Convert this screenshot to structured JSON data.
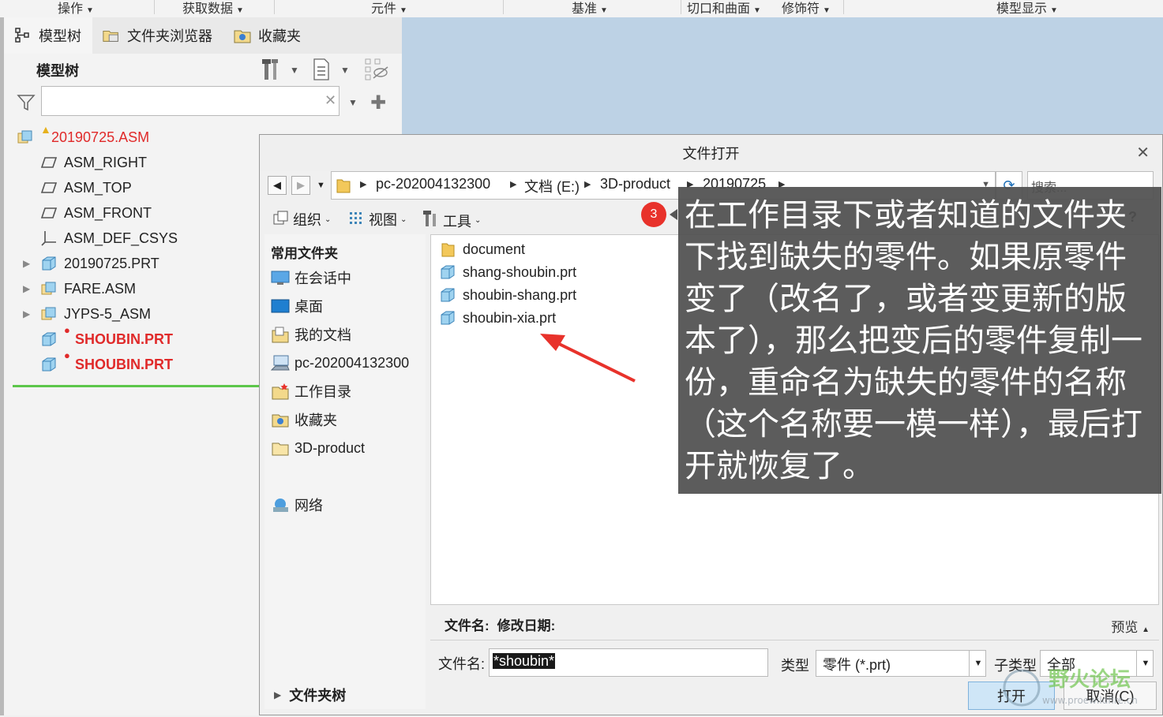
{
  "ribbon": {
    "groups": [
      "操作",
      "获取数据",
      "元件",
      "基准",
      "切口和曲面",
      "修饰符",
      "模型显示"
    ]
  },
  "left_panel": {
    "tabs": [
      {
        "label": "模型树",
        "icon": "model-tree-icon"
      },
      {
        "label": "文件夹浏览器",
        "icon": "folder-browser-icon"
      },
      {
        "label": "收藏夹",
        "icon": "favorites-icon"
      }
    ],
    "title": "模型树",
    "filter_placeholder": "",
    "tree": [
      {
        "label": "20190725.ASM",
        "style": "warn",
        "icon": "assembly-icon"
      },
      {
        "label": "ASM_RIGHT",
        "style": "normal",
        "icon": "datum-plane-icon"
      },
      {
        "label": "ASM_TOP",
        "style": "normal",
        "icon": "datum-plane-icon"
      },
      {
        "label": "ASM_FRONT",
        "style": "normal",
        "icon": "datum-plane-icon"
      },
      {
        "label": "ASM_DEF_CSYS",
        "style": "normal",
        "icon": "csys-icon"
      },
      {
        "label": "20190725.PRT",
        "style": "normal",
        "icon": "part-icon"
      },
      {
        "label": "FARE.ASM",
        "style": "normal",
        "icon": "assembly-icon"
      },
      {
        "label": "JYPS-5_ASM",
        "style": "normal",
        "icon": "assembly-icon"
      },
      {
        "label": "SHOUBIN.PRT",
        "style": "missing",
        "icon": "part-icon"
      },
      {
        "label": "SHOUBIN.PRT",
        "style": "missing",
        "icon": "part-icon"
      }
    ]
  },
  "dialog": {
    "title": "文件打开",
    "breadcrumbs": [
      "pc-202004132300",
      "文档 (E:)",
      "3D-product",
      "20190725"
    ],
    "search_placeholder": "搜索...",
    "toolbar": {
      "organize": "组织",
      "view": "视图",
      "tools": "工具",
      "help": "?"
    },
    "sidebar_header": "常用文件夹",
    "sidebar": [
      {
        "label": "在会话中",
        "icon": "session-icon"
      },
      {
        "label": "桌面",
        "icon": "desktop-icon"
      },
      {
        "label": "我的文档",
        "icon": "documents-icon"
      },
      {
        "label": "pc-202004132300",
        "icon": "computer-icon"
      },
      {
        "label": "工作目录",
        "icon": "working-dir-icon"
      },
      {
        "label": "收藏夹",
        "icon": "favorites-icon"
      },
      {
        "label": "3D-product",
        "icon": "folder-icon"
      },
      {
        "label": "网络",
        "icon": "network-icon"
      }
    ],
    "folder_tree_label": "文件夹树",
    "files": [
      {
        "name": "document",
        "icon": "folder-icon"
      },
      {
        "name": "shang-shoubin.prt",
        "icon": "part-icon"
      },
      {
        "name": "shoubin-shang.prt",
        "icon": "part-icon"
      },
      {
        "name": "shoubin-xia.prt",
        "icon": "part-icon"
      }
    ],
    "info": {
      "name_label": "文件名:",
      "date_label": "修改日期:",
      "preview": "预览"
    },
    "filename_label": "文件名:",
    "filename_value": "*shoubin*",
    "type_label": "类型",
    "type_value": "零件 (*.prt)",
    "subtype_label": "子类型",
    "subtype_value": "全部",
    "open_label": "打开",
    "cancel_label": "取消(C)"
  },
  "annotation": {
    "badge": "3",
    "text": "在工作目录下或者知道的文件夹下找到缺失的零件。如果原零件变了（改名了，或者变更新的版本了），那么把变后的零件复制一份，重命名为缺失的零件的名称（这个名称要一模一样），最后打开就恢复了。"
  },
  "watermark": {
    "text": "野火论坛",
    "url": "www.proewildfire.cn"
  },
  "colors": {
    "accent_red": "#e02a2a",
    "tree_line_green": "#5cc64a",
    "canvas_blue": "#bdd2e5"
  }
}
